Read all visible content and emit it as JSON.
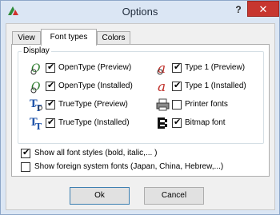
{
  "window": {
    "title": "Options"
  },
  "titlebar": {
    "help_label": "?",
    "close_label": "✕"
  },
  "tabs": [
    {
      "label": "View",
      "active": false
    },
    {
      "label": "Font types",
      "active": true
    },
    {
      "label": "Colors",
      "active": false
    }
  ],
  "display": {
    "group_label": "Display",
    "left_items": [
      {
        "label": "OpenType (Preview)",
        "checked": true,
        "icon": "opentype-icon"
      },
      {
        "label": "OpenType (Installed)",
        "checked": true,
        "icon": "opentype-installed-icon"
      },
      {
        "label": "TrueType (Preview)",
        "checked": true,
        "icon": "truetype-icon"
      },
      {
        "label": "TrueType (Installed)",
        "checked": true,
        "icon": "truetype-installed-icon"
      }
    ],
    "right_items": [
      {
        "label": "Type 1 (Preview)",
        "checked": true,
        "icon": "type1-icon"
      },
      {
        "label": "Type 1 (Installed)",
        "checked": true,
        "icon": "type1-installed-icon"
      },
      {
        "label": "Printer fonts",
        "checked": false,
        "icon": "printer-icon"
      },
      {
        "label": "Bitmap font",
        "checked": true,
        "icon": "bitmap-font-icon"
      }
    ]
  },
  "options": {
    "show_all_styles": {
      "label": "Show all font styles (bold, italic,... )",
      "checked": true
    },
    "show_foreign": {
      "label": "Show foreign system fonts (Japan, China, Hebrew,...)",
      "checked": false
    }
  },
  "buttons": {
    "ok": "Ok",
    "cancel": "Cancel"
  },
  "check_glyph": "✔",
  "icon_glyphs": {
    "opentype": "O",
    "truetype": "T",
    "type1": "a"
  }
}
